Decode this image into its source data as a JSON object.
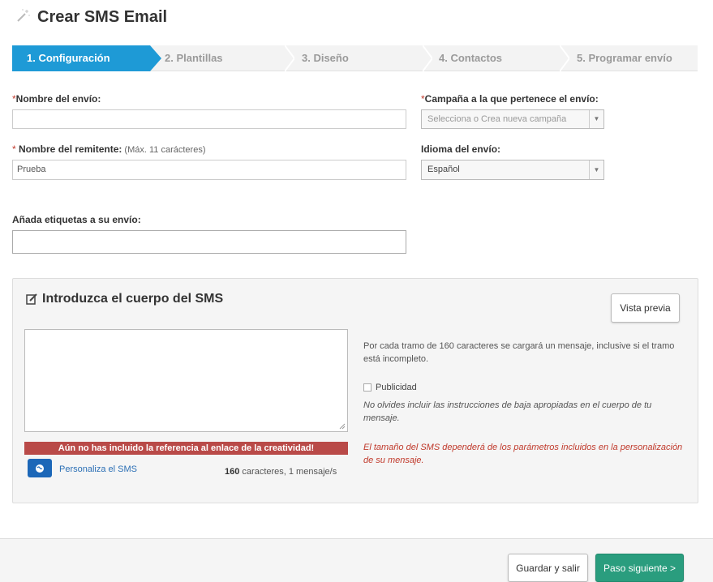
{
  "header": {
    "title": "Crear SMS Email"
  },
  "steps": [
    {
      "label": "1. Configuración"
    },
    {
      "label": "2. Plantillas"
    },
    {
      "label": "3. Diseño"
    },
    {
      "label": "4. Contactos"
    },
    {
      "label": "5. Programar envío"
    }
  ],
  "form": {
    "send_name": {
      "req": "*",
      "label": "Nombre del envío:",
      "value": ""
    },
    "campaign": {
      "req": "*",
      "label": "Campaña a la que pertenece el envío:",
      "placeholder": "Selecciona o Crea nueva campaña"
    },
    "sender": {
      "req": "* ",
      "label": "Nombre del remitente:",
      "hint": " (Máx. 11 carácteres)",
      "value": "Prueba"
    },
    "language": {
      "label": "Idioma del envío:",
      "value": "Español"
    },
    "tags": {
      "label": "Añada etiquetas a su envío:",
      "value": ""
    }
  },
  "sms": {
    "title": "Introduzca el cuerpo del SMS",
    "preview_button": "Vista previa",
    "warning": "Aún no has incluido la referencia al enlace de la creatividad!",
    "personalize": "Personaliza el SMS",
    "count_num": "160",
    "count_text": " caracteres, 1 mensaje/s",
    "info1": "Por cada tramo de 160 caracteres se cargará un mensaje, inclusive si el tramo está incompleto.",
    "checkbox_label": "Publicidad",
    "info2": "No olvides incluir las instrucciones de baja apropiadas en el cuerpo de tu mensaje.",
    "info3": "El tamaño del SMS dependerá de los parámetros incluidos en la personalización de su mensaje."
  },
  "footer": {
    "save_exit": "Guardar y salir",
    "next": "Paso siguiente >"
  }
}
